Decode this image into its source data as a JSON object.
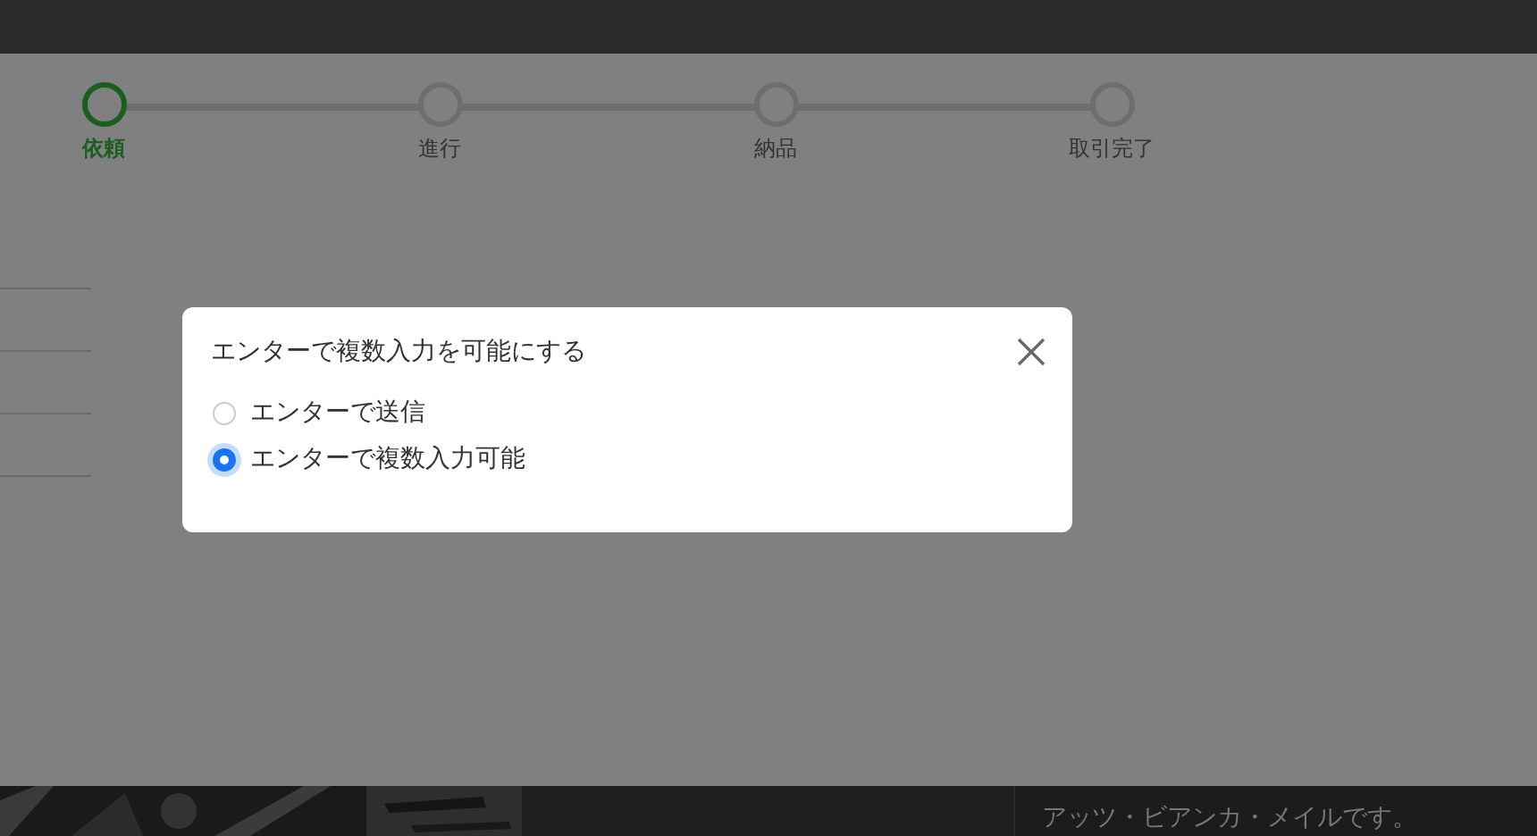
{
  "progress_steps": [
    {
      "label": "依頼",
      "selected": true
    },
    {
      "label": "進行",
      "selected": false
    },
    {
      "label": "納品",
      "selected": false
    },
    {
      "label": "取引完了",
      "selected": false
    }
  ],
  "dialog": {
    "title": "エンターで複数入力を可能にする",
    "options": [
      {
        "label": "エンターで送信",
        "selected": false
      },
      {
        "label": "エンターで複数入力可能",
        "selected": true
      }
    ]
  },
  "message_preview": "アッツ・ビアンカ・メイルです。"
}
